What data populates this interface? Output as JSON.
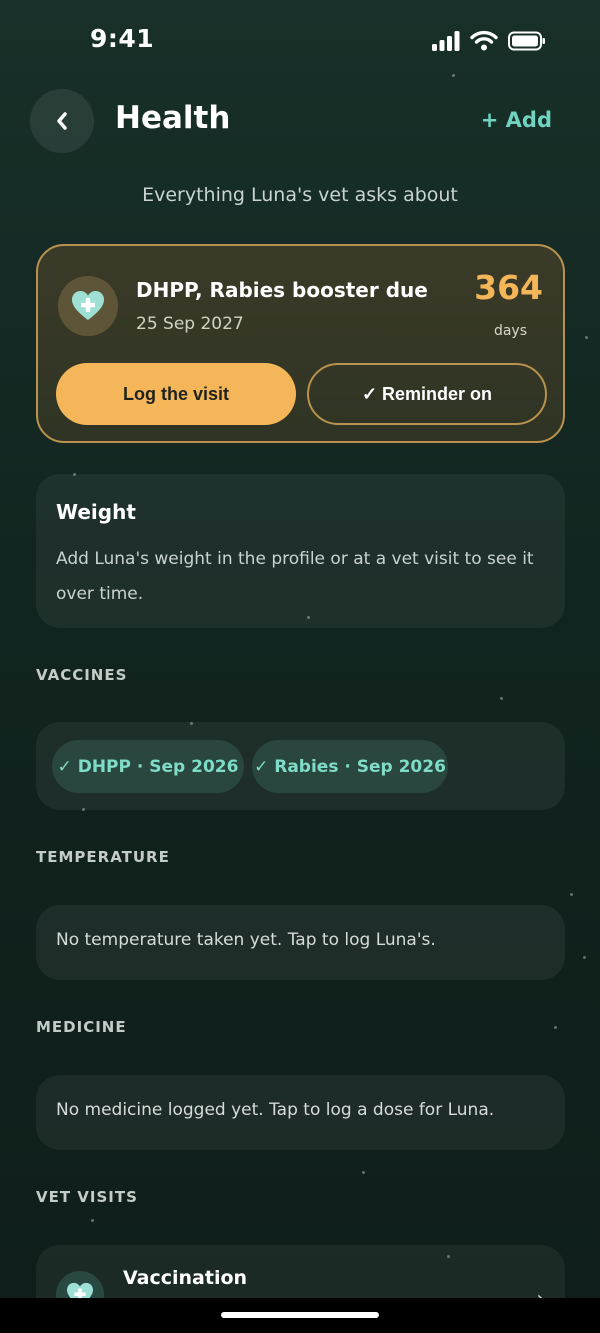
{
  "status_bar": {
    "time": "9:41"
  },
  "header": {
    "title": "Health",
    "add_label": "+ Add"
  },
  "subtitle": "Everything Luna's vet asks about",
  "reminder": {
    "title": "DHPP, Rabies booster due",
    "date": "25 Sep 2027",
    "days_count": "364",
    "days_label": "days",
    "log_button": "Log the visit",
    "reminder_button": "✓ Reminder on"
  },
  "weight": {
    "title": "Weight",
    "text": "Add Luna's weight in the profile or at a vet visit to see it over time."
  },
  "vaccines": {
    "label": "VACCINES",
    "chips": [
      "✓ DHPP · Sep 2026",
      "✓ Rabies · Sep 2026"
    ]
  },
  "temperature": {
    "label": "TEMPERATURE",
    "text": "No temperature taken yet. Tap to log Luna's."
  },
  "medicine": {
    "label": "MEDICINE",
    "text": "No medicine logged yet. Tap to log a dose for Luna."
  },
  "vet_visits": {
    "label": "VET VISITS",
    "items": [
      {
        "title": "Vaccination"
      }
    ]
  },
  "colors": {
    "accent": "#f5b65a",
    "teal": "#6fd3c0",
    "card_border": "#b8924e"
  },
  "icons": [
    "back-chevron-icon",
    "heart-plus-icon",
    "chevron-right-icon",
    "signal-icon",
    "wifi-icon",
    "battery-icon"
  ]
}
